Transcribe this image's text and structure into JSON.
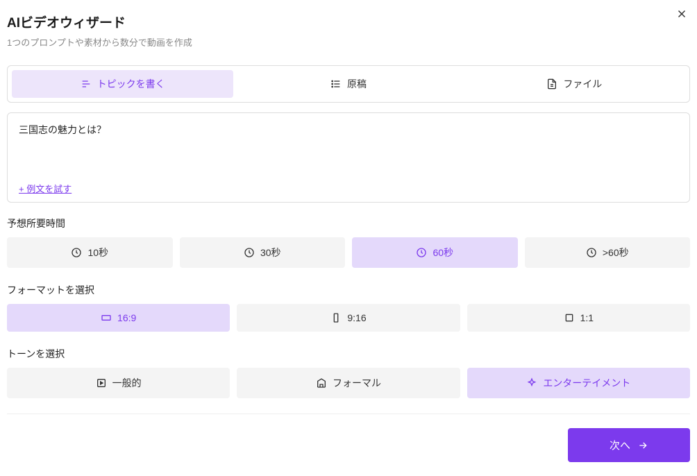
{
  "header": {
    "title": "AIビデオウィザード",
    "subtitle": "1つのプロンプトや素材から数分で動画を作成"
  },
  "tabs": {
    "topic": "トピックを書く",
    "script": "原稿",
    "file": "ファイル"
  },
  "prompt": {
    "text": "三国志の魅力とは？",
    "try_example": "+ 例文を試す"
  },
  "duration": {
    "label": "予想所要時間",
    "opt1": "10秒",
    "opt2": "30秒",
    "opt3": "60秒",
    "opt4": ">60秒"
  },
  "format": {
    "label": "フォーマットを選択",
    "opt1": "16:9",
    "opt2": "9:16",
    "opt3": "1:1"
  },
  "tone": {
    "label": "トーンを選択",
    "opt1": "一般的",
    "opt2": "フォーマル",
    "opt3": "エンターテイメント"
  },
  "footer": {
    "next": "次へ"
  }
}
